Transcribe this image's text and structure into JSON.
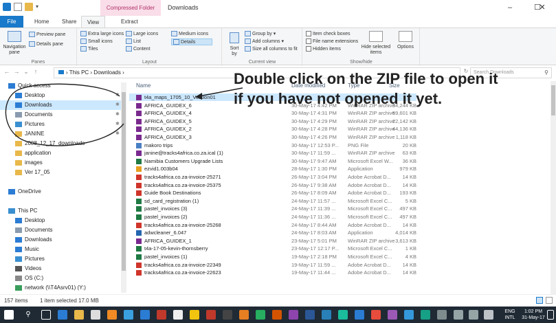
{
  "window": {
    "context_tab": "Compressed Folder Tools",
    "title": "Downloads",
    "min": "–",
    "max": "☐",
    "close": "✕"
  },
  "ribbon_tabs": [
    "File",
    "Home",
    "Share",
    "View",
    "Extract"
  ],
  "ribbon": {
    "panes": {
      "nav_pane": "Navigation pane",
      "preview": "Preview pane",
      "details": "Details pane",
      "label": "Panes"
    },
    "layout": {
      "items": [
        "Extra large icons",
        "Large icons",
        "Medium icons",
        "Small icons",
        "List",
        "Details",
        "Tiles",
        "Content"
      ],
      "label": "Layout"
    },
    "current_view": {
      "sort": "Sort by",
      "group": "Group by",
      "add_columns": "Add columns",
      "size_all": "Size all columns to fit",
      "label": "Current view"
    },
    "show_hide": {
      "item_check": "Item check boxes",
      "file_ext": "File name extensions",
      "hidden": "Hidden items",
      "hide_selected": "Hide selected items",
      "options": "Options",
      "label": "Show/hide"
    }
  },
  "address": {
    "path": "›  This PC  ›  Downloads  ›",
    "search_placeholder": "Search Downloads"
  },
  "nav_items": [
    {
      "label": "Quick access",
      "icon": "star-icon",
      "indent": 0,
      "color": "#2b7cd3",
      "pin": false
    },
    {
      "label": "Desktop",
      "icon": "desktop-icon",
      "indent": 1,
      "color": "#2b7cd3",
      "pin": true
    },
    {
      "label": "Downloads",
      "icon": "download-icon",
      "indent": 1,
      "color": "#2b7cd3",
      "pin": true,
      "selected": true
    },
    {
      "label": "Documents",
      "icon": "documents-icon",
      "indent": 1,
      "color": "#8a9bb0",
      "pin": true
    },
    {
      "label": "Pictures",
      "icon": "pictures-icon",
      "indent": 1,
      "color": "#3a8fd0",
      "pin": true
    },
    {
      "label": "JANINE",
      "icon": "folder-icon",
      "indent": 1,
      "color": "#e8b84a",
      "pin": true
    },
    {
      "label": "2008_12_17_downloads",
      "icon": "folder-icon",
      "indent": 1,
      "color": "#e8b84a",
      "pin": false
    },
    {
      "label": "application",
      "icon": "folder-icon",
      "indent": 1,
      "color": "#e8b84a",
      "pin": false
    },
    {
      "label": "images",
      "icon": "folder-icon",
      "indent": 1,
      "color": "#e8b84a",
      "pin": false
    },
    {
      "label": "Ver 17_05",
      "icon": "folder-icon",
      "indent": 1,
      "color": "#e8b84a",
      "pin": false
    },
    {
      "label": "",
      "icon": "",
      "indent": 0,
      "color": "",
      "pin": false
    },
    {
      "label": "OneDrive",
      "icon": "cloud-icon",
      "indent": 0,
      "color": "#2b7cd3",
      "pin": false
    },
    {
      "label": "",
      "icon": "",
      "indent": 0,
      "color": "",
      "pin": false
    },
    {
      "label": "This PC",
      "icon": "computer-icon",
      "indent": 0,
      "color": "#3a8fd0",
      "pin": false
    },
    {
      "label": "Desktop",
      "icon": "desktop-icon",
      "indent": 1,
      "color": "#2b7cd3",
      "pin": false
    },
    {
      "label": "Documents",
      "icon": "documents-icon",
      "indent": 1,
      "color": "#8a9bb0",
      "pin": false
    },
    {
      "label": "Downloads",
      "icon": "download-icon",
      "indent": 1,
      "color": "#2b7cd3",
      "pin": false
    },
    {
      "label": "Music",
      "icon": "music-icon",
      "indent": 1,
      "color": "#2b7cd3",
      "pin": false
    },
    {
      "label": "Pictures",
      "icon": "pictures-icon",
      "indent": 1,
      "color": "#3a8fd0",
      "pin": false
    },
    {
      "label": "Videos",
      "icon": "videos-icon",
      "indent": 1,
      "color": "#555",
      "pin": false
    },
    {
      "label": "OS (C:)",
      "icon": "drive-icon",
      "indent": 1,
      "color": "#888",
      "pin": false
    },
    {
      "label": "network (\\\\T4Asrv01) (Y:)",
      "icon": "network-drive-icon",
      "indent": 1,
      "color": "#3a9d5c",
      "pin": false
    }
  ],
  "columns": {
    "name": "Name",
    "date": "Date modified",
    "type": "Type",
    "size": "Size"
  },
  "files": [
    {
      "name": "t4a_maps_1705_10_Version01",
      "date": "",
      "type": "",
      "size": "",
      "icon": "zip",
      "selected": true
    },
    {
      "name": "AFRICA_GUIDEX_6",
      "date": "30-May-17 4:42 PM",
      "type": "WinRAR ZIP archive",
      "size": "34,244 KB",
      "icon": "zip"
    },
    {
      "name": "AFRICA_GUIDEX_4",
      "date": "30-May-17 4:31 PM",
      "type": "WinRAR ZIP archive",
      "size": "59,601 KB",
      "icon": "zip"
    },
    {
      "name": "AFRICA_GUIDEX_5",
      "date": "30-May-17 4:29 PM",
      "type": "WinRAR ZIP archive",
      "size": "22,142 KB",
      "icon": "zip"
    },
    {
      "name": "AFRICA_GUIDEX_2",
      "date": "30-May-17 4:28 PM",
      "type": "WinRAR ZIP archive",
      "size": "44,136 KB",
      "icon": "zip"
    },
    {
      "name": "AFRICA_GUIDEX_3",
      "date": "30-May-17 4:26 PM",
      "type": "WinRAR ZIP archive",
      "size": "1,118 KB",
      "icon": "zip"
    },
    {
      "name": "makoro trips",
      "date": "30-May-17 12:53 P...",
      "type": "PNG File",
      "size": "20 KB",
      "icon": "png"
    },
    {
      "name": "janine@tracks4africa.co.za.ical (1)",
      "date": "30-May-17 11:59 ...",
      "type": "WinRAR ZIP archive",
      "size": "63 KB",
      "icon": "zip"
    },
    {
      "name": "Namibia Customers Upgrade Lists",
      "date": "30-May-17 9:47 AM",
      "type": "Microsoft Excel W...",
      "size": "36 KB",
      "icon": "xls"
    },
    {
      "name": "ezvid1.003b04",
      "date": "28-May-17 1:30 PM",
      "type": "Application",
      "size": "979 KB",
      "icon": "app"
    },
    {
      "name": "tracks4africa.co.za-invoice-25271",
      "date": "26-May-17 3:04 PM",
      "type": "Adobe Acrobat D...",
      "size": "14 KB",
      "icon": "pdf"
    },
    {
      "name": "tracks4africa.co.za-invoice-25375",
      "date": "26-May-17 9:38 AM",
      "type": "Adobe Acrobat D...",
      "size": "14 KB",
      "icon": "pdf"
    },
    {
      "name": "Guide Book Destinations",
      "date": "26-May-17 8:09 AM",
      "type": "Adobe Acrobat D...",
      "size": "193 KB",
      "icon": "pdf"
    },
    {
      "name": "sd_card_registration (1)",
      "date": "24-May-17 11:57 ...",
      "type": "Microsoft Excel C...",
      "size": "5 KB",
      "icon": "xls"
    },
    {
      "name": "pastel_invoices (3)",
      "date": "24-May-17 11:39 ...",
      "type": "Microsoft Excel C...",
      "size": "497 KB",
      "icon": "xls"
    },
    {
      "name": "pastel_invoices (2)",
      "date": "24-May-17 11:36 ...",
      "type": "Microsoft Excel C...",
      "size": "497 KB",
      "icon": "xls"
    },
    {
      "name": "tracks4africa.co.za-invoice-25268",
      "date": "24-May-17 8:44 AM",
      "type": "Adobe Acrobat D...",
      "size": "14 KB",
      "icon": "pdf"
    },
    {
      "name": "adwcleaner_6.047",
      "date": "24-May-17 8:03 AM",
      "type": "Application",
      "size": "4,014 KB",
      "icon": "adw"
    },
    {
      "name": "AFRICA_GUIDEX_1",
      "date": "23-May-17 5:01 PM",
      "type": "WinRAR ZIP archive",
      "size": "3,613 KB",
      "icon": "zip"
    },
    {
      "name": "t4a-17-05-kevin-thornsberry",
      "date": "23-May-17 12:17 P...",
      "type": "Microsoft Excel C...",
      "size": "1 KB",
      "icon": "xls"
    },
    {
      "name": "pastel_invoices (1)",
      "date": "19-May-17 2:18 PM",
      "type": "Microsoft Excel C...",
      "size": "4 KB",
      "icon": "xls"
    },
    {
      "name": "tracks4africa.co.za-invoice-22349",
      "date": "19-May-17 11:59 ...",
      "type": "Adobe Acrobat D...",
      "size": "14 KB",
      "icon": "pdf"
    },
    {
      "name": "tracks4africa.co.za-invoice-22623",
      "date": "19-May-17 11:44 ...",
      "type": "Adobe Acrobat D...",
      "size": "14 KB",
      "icon": "pdf"
    }
  ],
  "icon_colors": {
    "zip": "#7a2a8f",
    "png": "#4a7fc4",
    "xls": "#1f7a44",
    "app": "#e8a020",
    "pdf": "#d0352b",
    "adw": "#2466b0"
  },
  "status": {
    "count": "157 items",
    "selected": "1 item selected  17.0 MB"
  },
  "annotation": {
    "line1": "Double click on the ZIP file to open it",
    "line2": "if you have not opened it yet."
  },
  "taskbar": {
    "lang": "ENG",
    "layout": "INTL",
    "time": "1:02 PM",
    "date": "31-May-17"
  }
}
